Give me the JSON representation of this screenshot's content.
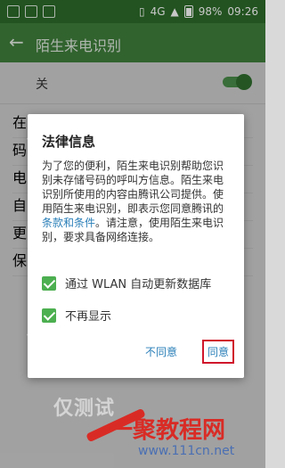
{
  "status_bar": {
    "left_icons": [
      "notification-icon",
      "image-icon",
      "mail-icon"
    ],
    "network_badge": "4G",
    "battery": "98%",
    "time": "09:26"
  },
  "app_bar": {
    "back_icon": "arrow-back-icon",
    "title": "陌生来电识别"
  },
  "settings": {
    "toggle_label": "关",
    "toggle_on": true,
    "bg_lines": [
      "在",
      "码",
      "电",
      "自",
      "更",
      "保"
    ]
  },
  "dialog": {
    "title": "法律信息",
    "body_before_link": "为了您的便利，陌生来电识别帮助您识别未存储号码的呼叫方信息。陌生来电识别所使用的内容由腾讯公司提供。使用陌生来电识别，即表示您同意腾讯的",
    "link": "条款和条件",
    "body_after_link": "。请注意，使用陌生来电识别，要求具备网络连接。",
    "check1_label": "通过 WLAN 自动更新数据库",
    "check2_label": "不再显示",
    "disagree": "不同意",
    "agree": "同意"
  },
  "watermark": {
    "text": "仅测试"
  },
  "brand": {
    "name": "一聚教程网",
    "url": "www.111cn.net"
  },
  "colors": {
    "status_bar": "#2c6b2a",
    "app_bar": "#3f7f3c",
    "accent": "#4caf50",
    "link": "#2a7fb8",
    "highlight_box": "#d0162b"
  }
}
